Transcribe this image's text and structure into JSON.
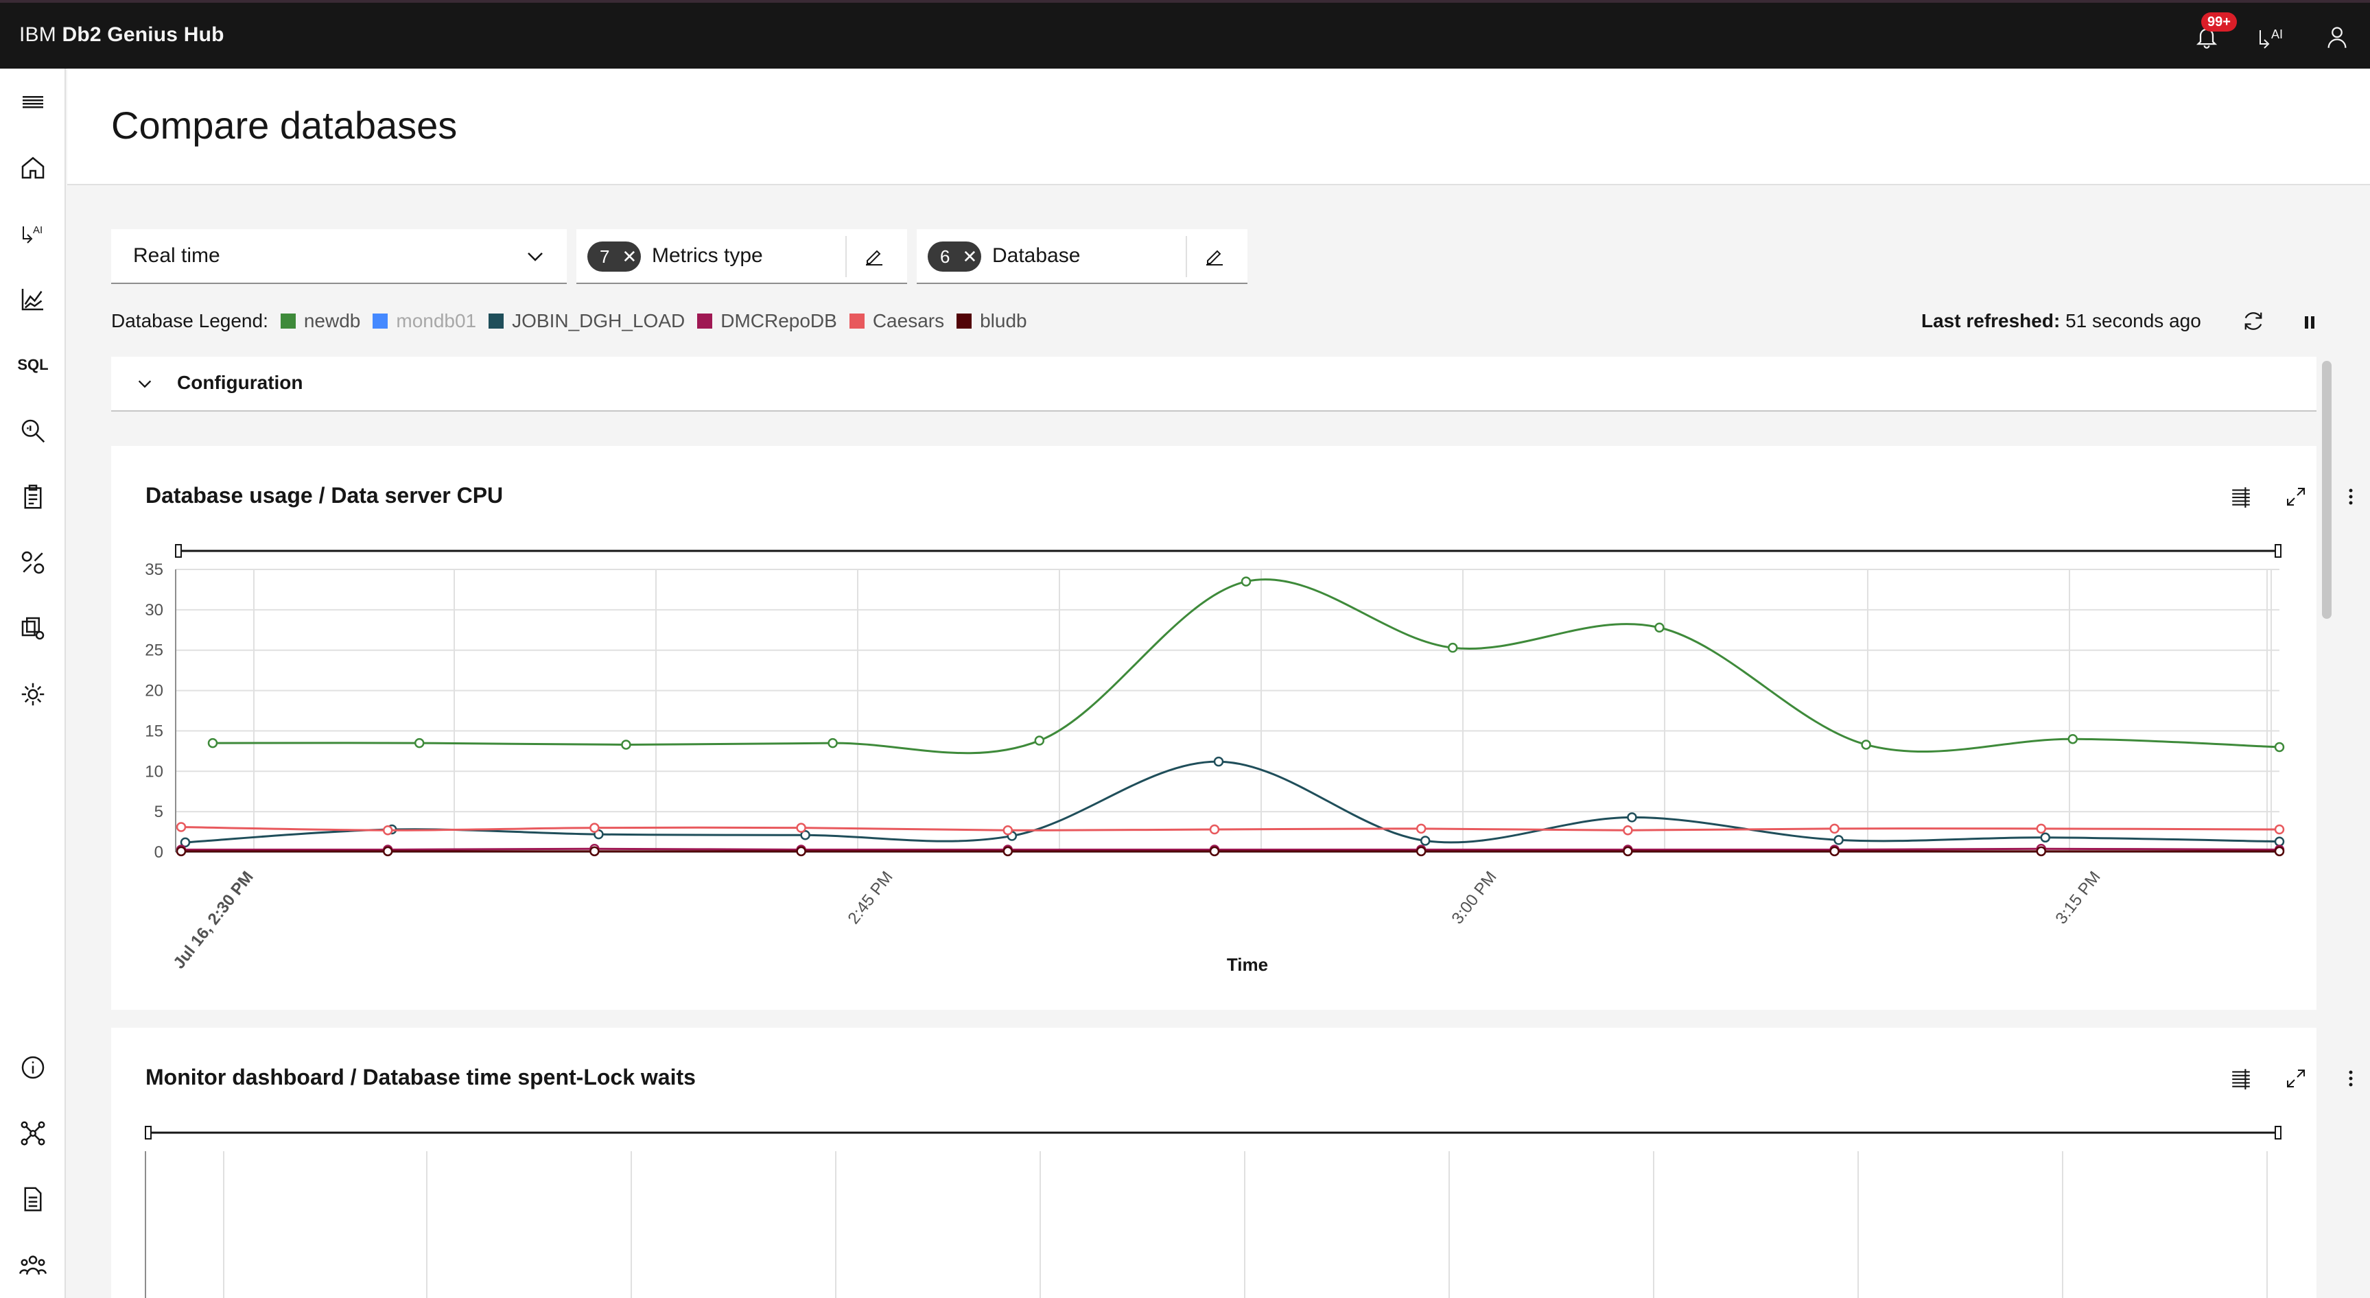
{
  "header": {
    "brand_prefix": "IBM",
    "brand_name": "Db2 Genius Hub",
    "notification_badge": "99+",
    "icons": [
      "notification-icon",
      "ai-assistant-icon",
      "user-icon"
    ]
  },
  "sidenav": {
    "icons": [
      "menu-icon",
      "home-icon",
      "ai-icon",
      "chart-icon",
      "sql-icon",
      "query-search-icon",
      "clipboard-icon",
      "tools-icon",
      "admin-icon",
      "settings-icon",
      "info-icon",
      "network-icon",
      "document-icon",
      "people-icon"
    ],
    "sql_label": "SQL",
    "ai_label": "AI"
  },
  "page": {
    "title": "Compare databases"
  },
  "filters": {
    "time_range": "Real time",
    "metrics_count": "7",
    "metrics_label": "Metrics type",
    "database_count": "6",
    "database_label": "Database"
  },
  "legend": {
    "label": "Database Legend:",
    "items": [
      {
        "name": "newdb",
        "color": "#3e8a3a",
        "enabled": true
      },
      {
        "name": "mondb01",
        "color": "#4589ff",
        "enabled": false
      },
      {
        "name": "JOBIN_DGH_LOAD",
        "color": "#1f4e5a",
        "enabled": true
      },
      {
        "name": "DMCRepoDB",
        "color": "#9f1853",
        "enabled": true
      },
      {
        "name": "Caesars",
        "color": "#e8595d",
        "enabled": true
      },
      {
        "name": "bludb",
        "color": "#520408",
        "enabled": true
      }
    ]
  },
  "refresh": {
    "label": "Last refreshed:",
    "value": "51 seconds ago"
  },
  "configuration": {
    "label": "Configuration"
  },
  "cards": {
    "cpu": {
      "title": "Database usage / Data server CPU"
    },
    "lock": {
      "title": "Monitor dashboard / Database time spent-Lock waits"
    }
  },
  "chart_data": [
    {
      "type": "line",
      "title": "Database usage / Data server CPU",
      "xlabel": "Time",
      "ylabel": "",
      "ylim": [
        0,
        35
      ],
      "yticks": [
        0,
        5,
        10,
        15,
        20,
        25,
        30,
        35
      ],
      "xticks": [
        "Jul 16, 2:30 PM",
        "2:45 PM",
        "3:00 PM",
        "3:15 PM"
      ],
      "x": [
        "2:31 PM",
        "2:36 PM",
        "2:41 PM",
        "2:46 PM",
        "2:51 PM",
        "2:56 PM",
        "3:01 PM",
        "3:06 PM",
        "3:11 PM",
        "3:16 PM",
        "3:21 PM"
      ],
      "series": [
        {
          "name": "newdb",
          "color": "#3e8a3a",
          "values": [
            13.5,
            13.5,
            13.3,
            13.5,
            13.8,
            33.5,
            25.3,
            27.8,
            13.3,
            14.0,
            13.0
          ]
        },
        {
          "name": "JOBIN_DGH_LOAD",
          "color": "#1f4e5a",
          "values": [
            1.2,
            2.8,
            2.2,
            2.1,
            2.0,
            11.2,
            1.4,
            4.3,
            1.5,
            1.8,
            1.3
          ]
        },
        {
          "name": "Caesars",
          "color": "#e8595d",
          "values": [
            3.1,
            2.7,
            3.0,
            3.0,
            2.7,
            2.8,
            2.9,
            2.7,
            2.9,
            2.9,
            2.8
          ]
        },
        {
          "name": "DMCRepoDB",
          "color": "#9f1853",
          "values": [
            0.3,
            0.3,
            0.4,
            0.3,
            0.3,
            0.3,
            0.3,
            0.3,
            0.3,
            0.4,
            0.3
          ]
        },
        {
          "name": "bludb",
          "color": "#520408",
          "values": [
            0.1,
            0.1,
            0.1,
            0.1,
            0.1,
            0.1,
            0.1,
            0.1,
            0.1,
            0.1,
            0.1
          ]
        }
      ]
    },
    {
      "type": "line",
      "title": "Monitor dashboard / Database time spent-Lock waits",
      "series": []
    }
  ]
}
